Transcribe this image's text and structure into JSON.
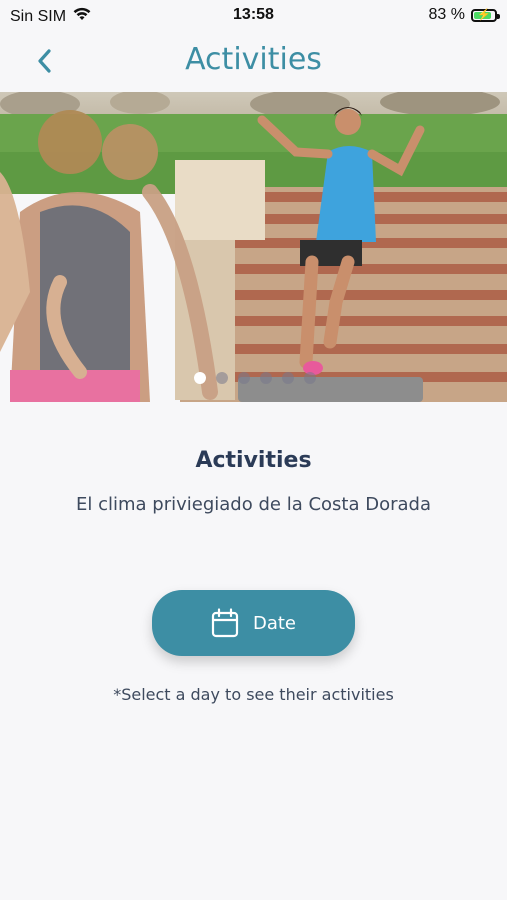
{
  "status_bar": {
    "carrier": "Sin SIM",
    "time": "13:58",
    "battery_percent_label": "83 %",
    "battery_level": 0.83
  },
  "nav": {
    "title": "Activities",
    "back_icon": "chevron-left-icon"
  },
  "hero": {
    "image": "photo of outdoor fitness class with instructor on stone steps",
    "carousel_pages": 6,
    "carousel_active": 0
  },
  "content": {
    "title": "Activities",
    "subtitle": "El clima priviegiado de la Costa Dorada"
  },
  "date_button": {
    "label": "Date",
    "icon": "calendar-icon"
  },
  "hint": "*Select a day to see their activities",
  "colors": {
    "accent": "#3d8ea4",
    "text_dark": "#2b3b57",
    "background": "#f7f7f9"
  }
}
